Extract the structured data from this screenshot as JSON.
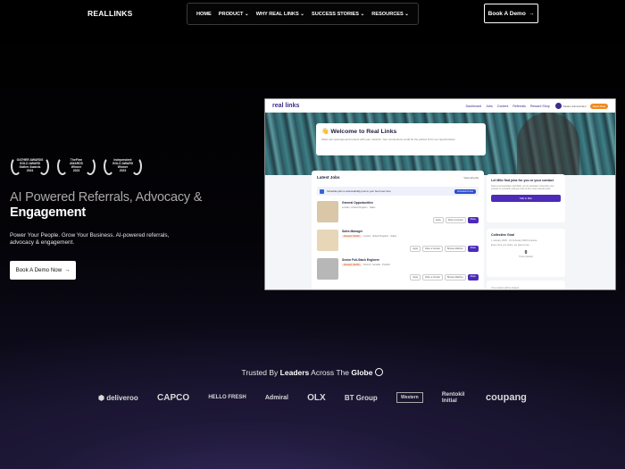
{
  "brand": "REALLINKS",
  "nav": {
    "items": [
      "HOME",
      "PRODUCT",
      "WHY REAL LINKS",
      "SUCCESS STORIES",
      "RESOURCES"
    ],
    "cta": "Book A Demo"
  },
  "hero": {
    "awards": [
      {
        "lines": [
          "GATHER AWARDS",
          "GOLD AWARD",
          "Gather Awards",
          "2024"
        ]
      },
      {
        "lines": [
          "TheFirm",
          "AWARDS",
          "Winner",
          "2023"
        ]
      },
      {
        "lines": [
          "Independent",
          "GOLD AWARD",
          "Winner",
          "2023"
        ]
      }
    ],
    "title_light": "AI Powered Referrals, Advocacy &",
    "title_bold": "Engagement",
    "subtitle": "Power Your People. Grow Your Business. AI-powered referrals, advocacy & engagement.",
    "cta": "Book A Demo Now"
  },
  "preview": {
    "logo": "real links",
    "links": [
      "Dashboard",
      "Jobs",
      "Content",
      "Referrals",
      "Reward Shop"
    ],
    "user": "Sadam Administrator",
    "options": "Select Role",
    "welcome": "👋 Welcome to Real Links",
    "welcome_sub": "Share job openings and content with your network. Your connections could be the perfect fit for our opportunities!",
    "latest_jobs": "Latest Jobs",
    "view_all": "View all jobs",
    "schedule_text": "Schedule jobs to automatically post to your feed over time",
    "schedule_btn": "Schedule Posts",
    "jobs": [
      {
        "title": "General Opportunities",
        "reward": "",
        "location": "London, United Kingdom",
        "dept": "Sales",
        "img": "#d9c7a8"
      },
      {
        "title": "Sales Manager",
        "reward": "Reward: $1000",
        "location": "London, United Kingdom",
        "dept": "Sales",
        "img": "#e7d6b7"
      },
      {
        "title": "Senior Full-Stack Engineer",
        "reward": "Reward: $1000",
        "location": "Toronto, Canada",
        "dept": "Product",
        "img": "#b7b7b7"
      }
    ],
    "actions": [
      "Apply",
      "Refer a Contact",
      "Browse Matches",
      "Share"
    ],
    "milo_title": "Let Milo find jobs for you or your contact",
    "milo_text": "Start a conversation with Milo, our AI assistant. Describe your contact or yourself, and get a list of the most relevant jobs.",
    "milo_btn": "Talk to Milo",
    "goal_title": "Collective Goal",
    "goal_dates": "1 January 2026 - 31 February 2026 Inclusive",
    "goal_text": "Every time you share, we plant a tree",
    "goal_num": "0",
    "goal_label": "Trees planted",
    "third_card": "Your content will be shared"
  },
  "trusted": {
    "before": "Trusted By ",
    "bold1": "Leaders",
    "middle": " Across The ",
    "bold2": "Globe"
  },
  "logos": [
    "deliveroo",
    "CAPCO",
    "HELLO FRESH",
    "Admiral",
    "OLX",
    "BT Group",
    "Western",
    "Rentokil Initial",
    "coupang"
  ]
}
